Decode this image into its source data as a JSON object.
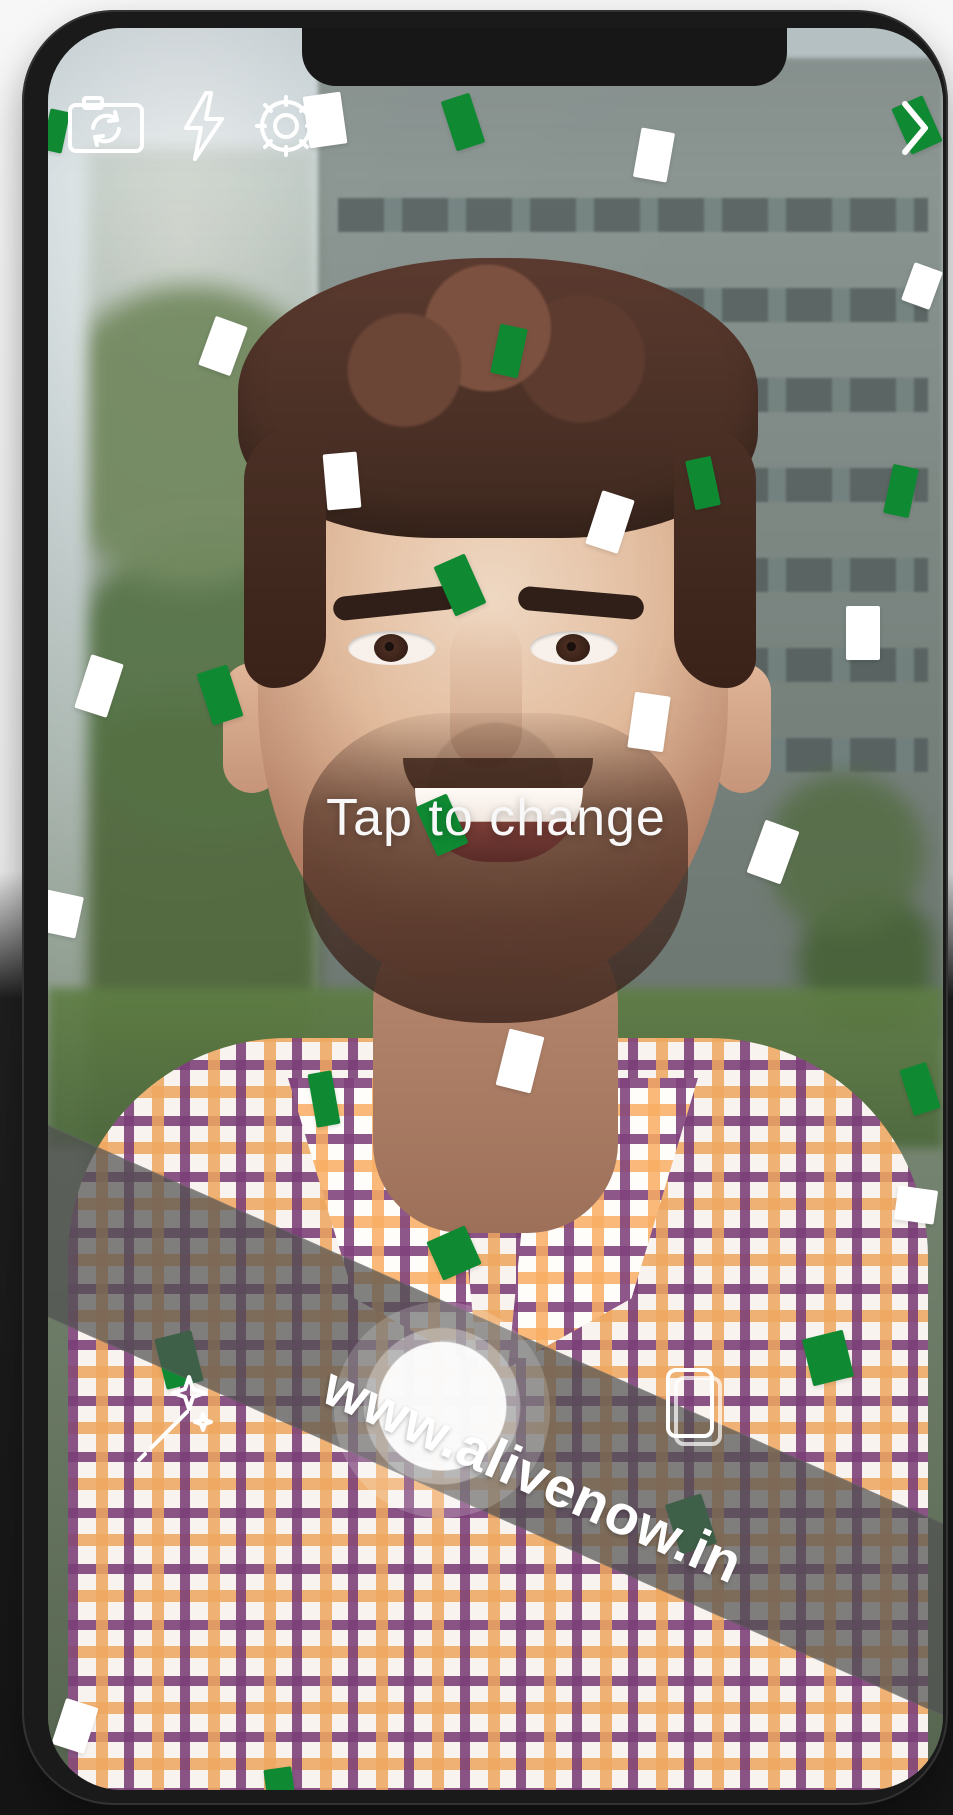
{
  "overlay": {
    "hint_text": "Tap to change",
    "watermark": "www.alivenow.in"
  },
  "icons": {
    "camera_switch": "camera-switch-icon",
    "flash": "flash-icon",
    "settings": "gear-icon",
    "next": "chevron-right-icon",
    "effects": "magic-wand-icon",
    "gallery": "gallery-icon"
  },
  "colors": {
    "confetti_green": "#0f8a33",
    "confetti_white": "#ffffff"
  }
}
